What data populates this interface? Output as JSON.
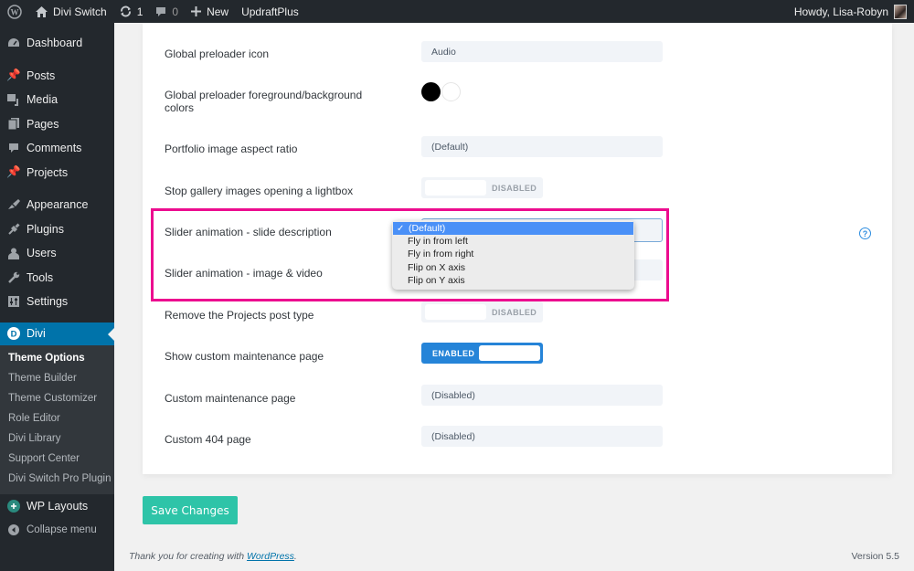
{
  "admin_bar": {
    "site_name": "Divi Switch",
    "updates_count": "1",
    "comments_count": "0",
    "new_label": "New",
    "plugin_label": "UpdraftPlus",
    "greeting": "Howdy, Lisa-Robyn"
  },
  "sidebar": {
    "items": [
      {
        "label": "Dashboard",
        "icon": "dashboard-icon"
      },
      {
        "label": "Posts",
        "icon": "pin-icon"
      },
      {
        "label": "Media",
        "icon": "media-icon"
      },
      {
        "label": "Pages",
        "icon": "pages-icon"
      },
      {
        "label": "Comments",
        "icon": "comment-icon"
      },
      {
        "label": "Projects",
        "icon": "pin-icon"
      },
      {
        "label": "Appearance",
        "icon": "brush-icon"
      },
      {
        "label": "Plugins",
        "icon": "plug-icon"
      },
      {
        "label": "Users",
        "icon": "user-icon"
      },
      {
        "label": "Tools",
        "icon": "wrench-icon"
      },
      {
        "label": "Settings",
        "icon": "sliders-icon"
      }
    ],
    "divi": {
      "label": "Divi",
      "submenu": [
        "Theme Options",
        "Theme Builder",
        "Theme Customizer",
        "Role Editor",
        "Divi Library",
        "Support Center",
        "Divi Switch Pro Plugin"
      ]
    },
    "wp_layouts": "WP Layouts",
    "collapse": "Collapse menu"
  },
  "settings": {
    "preloader_icon": {
      "label": "Global preloader icon",
      "value": "Audio"
    },
    "preloader_colors": {
      "label": "Global preloader foreground/background colors",
      "foreground": "#000000",
      "background": "#ffffff"
    },
    "portfolio_ratio": {
      "label": "Portfolio image aspect ratio",
      "value": "(Default)"
    },
    "gallery_lightbox": {
      "label": "Stop gallery images opening a lightbox",
      "state": "DISABLED"
    },
    "slider_desc": {
      "label": "Slider animation - slide description",
      "options": [
        "(Default)",
        "Fly in from left",
        "Fly in from right",
        "Flip on X axis",
        "Flip on Y axis"
      ],
      "selected": "(Default)"
    },
    "slider_media": {
      "label": "Slider animation - image & video"
    },
    "remove_projects": {
      "label": "Remove the Projects post type",
      "state": "DISABLED"
    },
    "maintenance_toggle": {
      "label": "Show custom maintenance page",
      "state": "ENABLED"
    },
    "maintenance_page": {
      "label": "Custom maintenance page",
      "value": "(Disabled)"
    },
    "page_404": {
      "label": "Custom 404 page",
      "value": "(Disabled)"
    }
  },
  "save_button": "Save Changes",
  "footer": {
    "thanks_prefix": "Thank you for creating with ",
    "link": "WordPress",
    "suffix": ".",
    "version": "Version 5.5"
  },
  "colors": {
    "accent": "#0073aa",
    "save": "#2ec4a8",
    "highlight": "#ec0c8f",
    "toggle_on": "#2584d8"
  }
}
